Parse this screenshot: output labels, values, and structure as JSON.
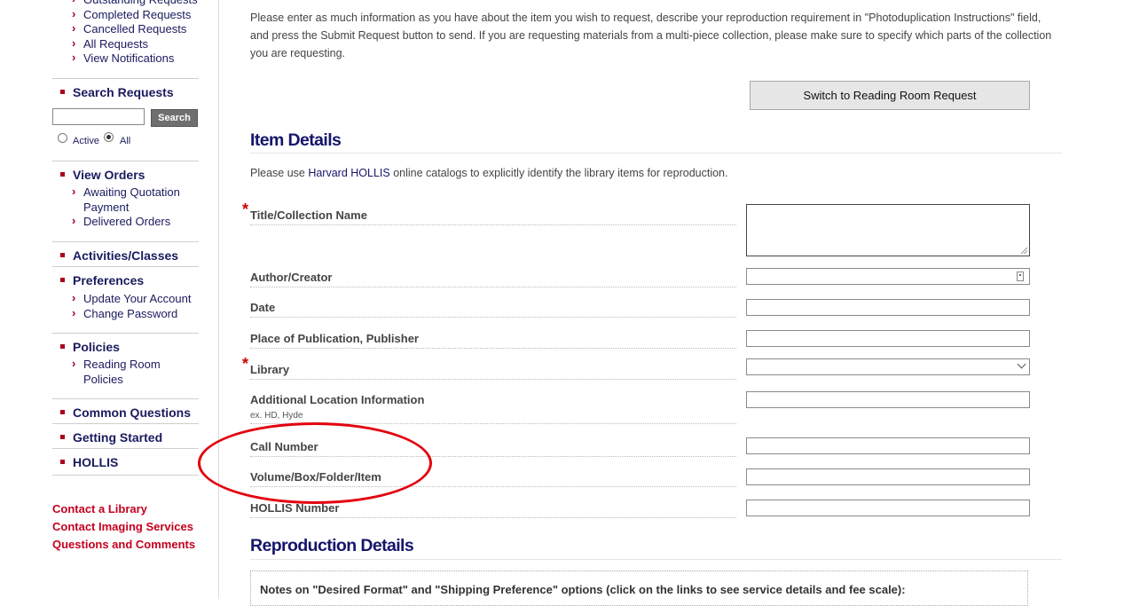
{
  "sidebar": {
    "requests_items": [
      "Outstanding Requests",
      "Completed Requests",
      "Cancelled Requests",
      "All Requests",
      "View Notifications"
    ],
    "search": {
      "title": "Search Requests",
      "input_value": "",
      "button": "Search",
      "radio_active": "Active",
      "radio_all": "All",
      "selected": "All"
    },
    "view_orders": {
      "title": "View Orders",
      "items": [
        "Awaiting Quotation Payment",
        "Delivered Orders"
      ]
    },
    "activities": "Activities/Classes",
    "preferences": {
      "title": "Preferences",
      "items": [
        "Update Your Account",
        "Change Password"
      ]
    },
    "policies": {
      "title": "Policies",
      "items": [
        "Reading Room Policies"
      ]
    },
    "common_questions": "Common Questions",
    "getting_started": "Getting Started",
    "hollis": "HOLLIS",
    "footer_links": [
      "Contact a Library",
      "Contact Imaging Services",
      "Questions and Comments"
    ]
  },
  "main": {
    "intro": "Please enter as much information as you have about the item you wish to request, describe your reproduction requirement in \"Photoduplication Instructions\" field, and press the Submit Request button to send. If you are requesting materials from a multi-piece collection, please make sure to specify which parts of the collection you are requesting.",
    "switch_button": "Switch to Reading Room Request",
    "item_details": {
      "heading": "Item Details",
      "note_prefix": "Please use ",
      "note_link": "Harvard HOLLIS",
      "note_suffix": " online catalogs to explicitly identify the library items for reproduction.",
      "fields": {
        "title": {
          "label": "Title/Collection Name",
          "value": ""
        },
        "author": {
          "label": "Author/Creator",
          "value": ""
        },
        "date": {
          "label": "Date",
          "value": ""
        },
        "place": {
          "label": "Place of Publication, Publisher",
          "value": ""
        },
        "library": {
          "label": "Library",
          "value": ""
        },
        "location": {
          "label": "Additional Location Information",
          "hint": "ex. HD, Hyde",
          "value": ""
        },
        "call_number": {
          "label": "Call Number",
          "value": ""
        },
        "volume": {
          "label": "Volume/Box/Folder/Item",
          "value": ""
        },
        "hollis_number": {
          "label": "HOLLIS Number",
          "value": ""
        }
      },
      "required_mark": "*"
    },
    "reproduction_details": {
      "heading": "Reproduction Details",
      "notes": "Notes on \"Desired Format\" and \"Shipping Preference\" options (click on the links to see service details and fee scale):"
    }
  },
  "colors": {
    "heading": "#15156b",
    "bullet": "#a8001f",
    "footer_link": "#c4001f",
    "annotation": "#e3000f"
  }
}
